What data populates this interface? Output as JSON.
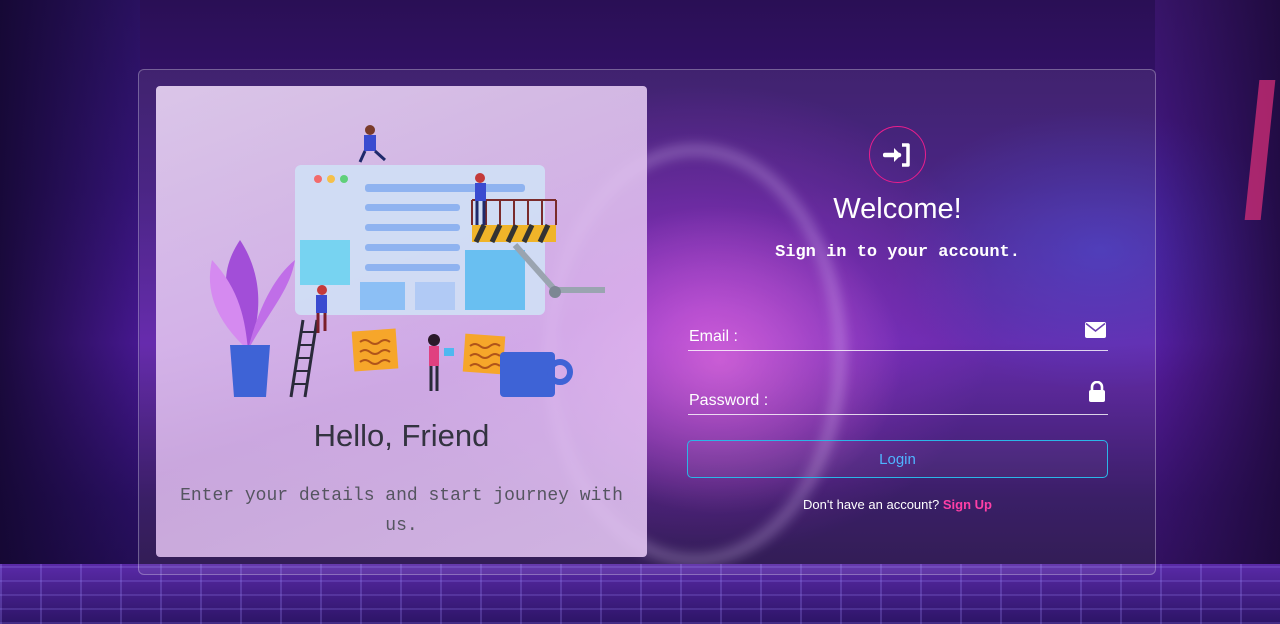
{
  "left_panel": {
    "heading": "Hello, Friend",
    "lead": "Enter your details and start journey with us."
  },
  "form": {
    "welcome": "Welcome!",
    "subtitle": "Sign in to your account.",
    "email_label": "Email :",
    "password_label": "Password :",
    "login_label": "Login",
    "no_account_text": "Don't have an account?",
    "signup_link": "Sign Up"
  },
  "icons": {
    "header": "login-icon",
    "email": "envelope-icon",
    "password": "lock-icon"
  },
  "colors": {
    "accent_pink": "#e91e8c",
    "signup_pink": "#ff3fa6",
    "button_border": "#2bb6e8",
    "button_text": "#4fb4ff"
  }
}
